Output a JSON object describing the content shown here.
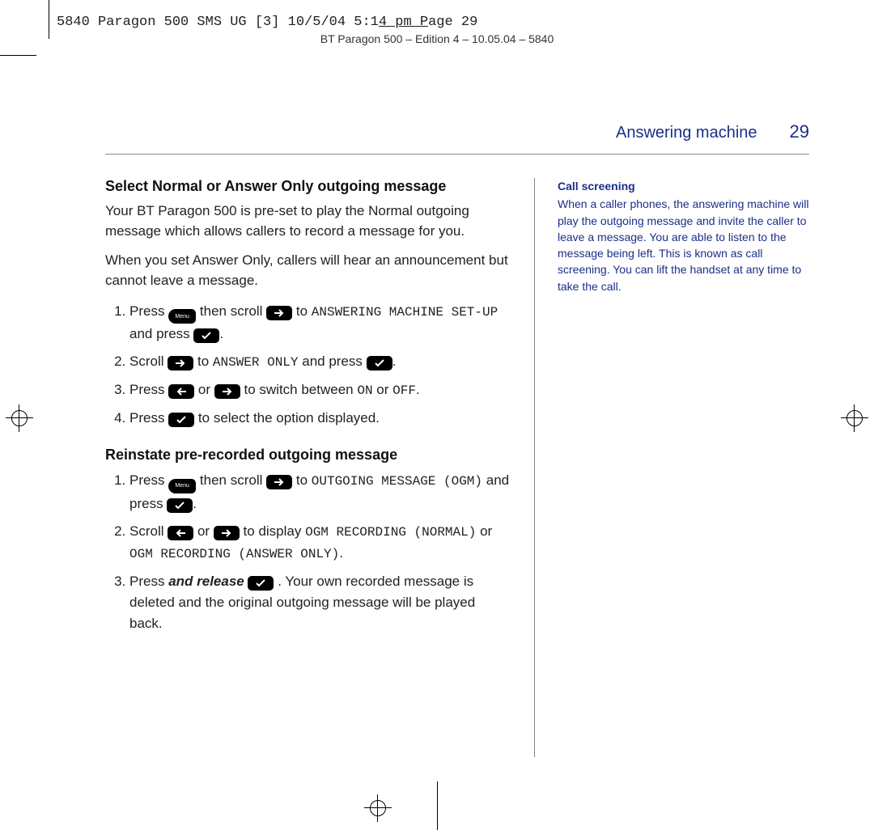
{
  "slug": {
    "pre": "5840 Paragon 500 SMS UG [3]  10/5/04  5:1",
    "underlined": "4  pm  P",
    "post": "age 29"
  },
  "edition_line": "BT Paragon 500 – Edition 4 – 10.05.04 – 5840",
  "header": {
    "section": "Answering machine",
    "page": "29"
  },
  "main": {
    "h1": "Select Normal or Answer Only outgoing message",
    "p1": "Your BT Paragon 500 is pre-set to play the Normal outgoing message which allows callers to record a message for you.",
    "p2": "When you set Answer Only, callers will hear an announcement but cannot leave a message.",
    "s1": {
      "pre": "Press ",
      "mid1": " then scroll ",
      "lcd1": "ANSWERING MACHINE SET-UP",
      "mid2": " to ",
      "end": " and press "
    },
    "s2": {
      "pre": "Scroll ",
      "mid": " to ",
      "lcd": "ANSWER ONLY",
      "end": " and press "
    },
    "s3": {
      "pre": "Press ",
      "or": " or ",
      "mid": " to switch between ",
      "on": "ON",
      "or2": " or ",
      "off": "OFF",
      "dot": "."
    },
    "s4": {
      "pre": "Press ",
      "end": " to select the option displayed."
    },
    "h2": "Reinstate pre-recorded outgoing message",
    "r1": {
      "pre": "Press ",
      "mid1": " then scroll ",
      "to": " to ",
      "lcd": "OUTGOING MESSAGE (OGM)",
      "end": " and press "
    },
    "r2": {
      "pre": "Scroll ",
      "or": " or ",
      "mid": " to display ",
      "lcd1": "OGM RECORDING (NORMAL)",
      "or2": " or ",
      "lcd2": "OGM RECORDING (ANSWER ONLY)",
      "dot": "."
    },
    "r3": {
      "pre": "Press ",
      "emph": "and release",
      "mid": ". Your own recorded message is deleted and the original outgoing message will be played back."
    }
  },
  "side": {
    "title": "Call screening",
    "body": "When a caller phones, the answering machine will play the outgoing message and invite the caller to leave a message. You are able to listen to the message being left. This is known as call screening. You can lift the handset at any time to take the call."
  },
  "icons": {
    "menu_label": "Menu"
  }
}
